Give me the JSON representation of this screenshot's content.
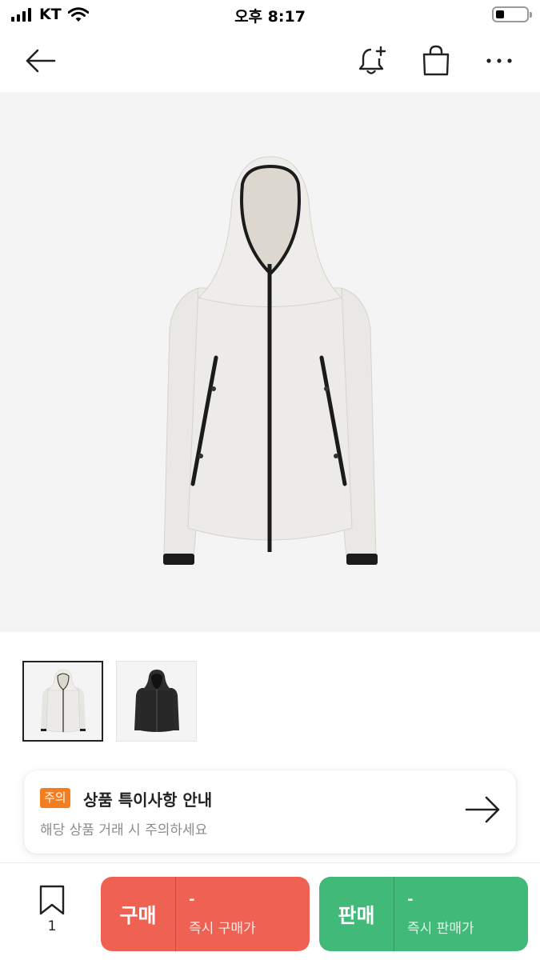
{
  "status_bar": {
    "carrier": "KT",
    "time": "오후 8:17"
  },
  "header": {
    "back_icon": "arrow-left-icon",
    "alert_icon": "bell-plus-icon",
    "bag_icon": "shopping-bag-icon",
    "more_icon": "more-horizontal-icon"
  },
  "product": {
    "main_image": "white-hooded-jacket",
    "thumbnails": [
      {
        "color": "white",
        "selected": true
      },
      {
        "color": "black",
        "selected": false
      }
    ]
  },
  "notice": {
    "badge": "주의",
    "title": "상품 특이사항 안내",
    "subtitle": "해당 상품 거래 시 주의하세요"
  },
  "bottom_bar": {
    "bookmark_count": "1",
    "buy": {
      "label": "구매",
      "price": "-",
      "price_label": "즉시 구매가",
      "color": "#ef6253"
    },
    "sell": {
      "label": "판매",
      "price": "-",
      "price_label": "즉시 판매가",
      "color": "#41b979"
    }
  }
}
